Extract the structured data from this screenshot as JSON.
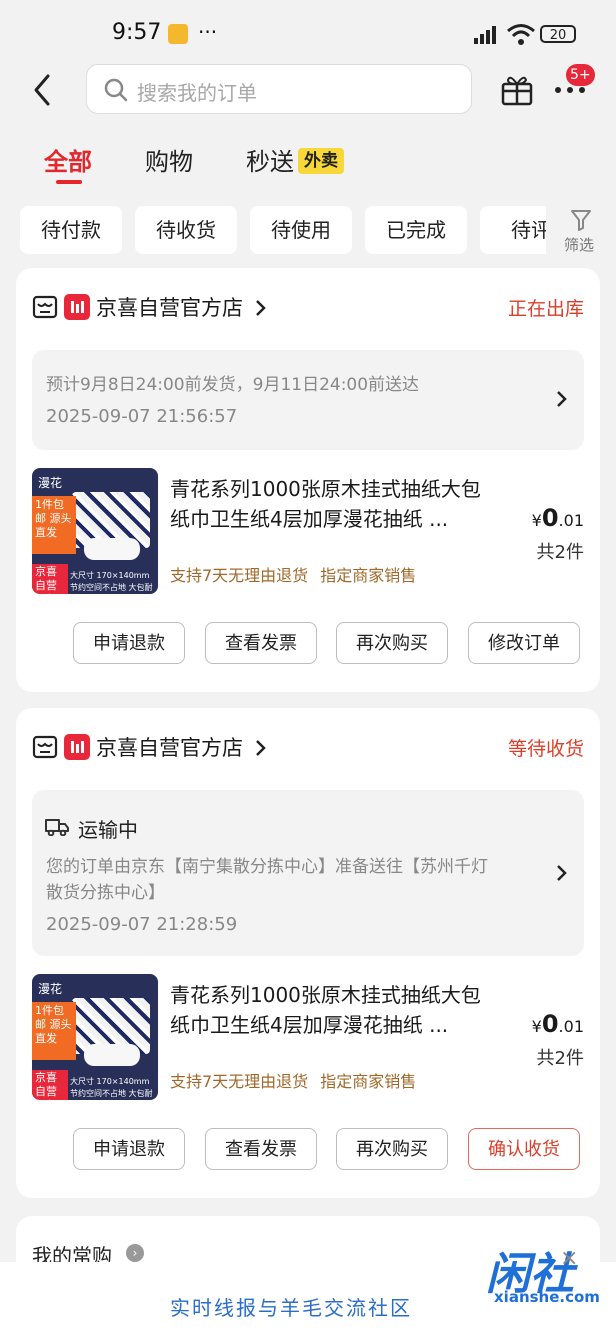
{
  "status_bar": {
    "time": "9:57",
    "dots": "···",
    "battery": "20"
  },
  "search": {
    "placeholder": "搜索我的订单"
  },
  "header": {
    "badge": "5+"
  },
  "tabs": [
    {
      "label": "全部",
      "active": true
    },
    {
      "label": "购物",
      "active": false
    },
    {
      "label": "秒送",
      "active": false,
      "tag": "外卖"
    }
  ],
  "filters": [
    "待付款",
    "待收货",
    "待使用",
    "已完成",
    "待评"
  ],
  "filter_button": "筛选",
  "orders": [
    {
      "shop": "京喜自营官方店",
      "status": "正在出库",
      "ship_lines": [
        "预计9月8日24:00前发货，9月11日24:00前送达"
      ],
      "time": "2025-09-07 21:56:57",
      "product": {
        "title": "青花系列1000张原木挂式抽纸大包纸巾卫生纸4层加厚漫花抽纸 ...",
        "price_symbol": "¥",
        "price_int": "0",
        "price_dec": ".01",
        "qty": "共2件",
        "tags": [
          "支持7天无理由退货",
          "指定商家销售"
        ]
      },
      "buttons": [
        "申请退款",
        "查看发票",
        "再次购买",
        "修改订单"
      ]
    },
    {
      "shop": "京喜自营官方店",
      "status": "等待收货",
      "transit_title": "运输中",
      "ship_lines": [
        "您的订单由京东【南宁集散分拣中心】准备送往【苏州千灯",
        "散货分拣中心】"
      ],
      "time": "2025-09-07 21:28:59",
      "product": {
        "title": "青花系列1000张原木挂式抽纸大包纸巾卫生纸4层加厚漫花抽纸 ...",
        "price_symbol": "¥",
        "price_int": "0",
        "price_dec": ".01",
        "qty": "共2件",
        "tags": [
          "支持7天无理由退货",
          "指定商家销售"
        ]
      },
      "buttons": [
        "申请退款",
        "查看发票",
        "再次购买",
        "确认收货"
      ]
    }
  ],
  "thumb": {
    "brand": "漫花",
    "promo": "1件包邮 源头直发",
    "promo2": "京喜自营 包邮",
    "size": "大尺寸 170×140mm",
    "slogan": "节约空间不占地 大包耐用"
  },
  "frequent": {
    "title": "我的常购"
  },
  "watermark": {
    "slogan": "实时线报与羊毛交流社区",
    "logo": "闲社",
    "domain": "xianshe.com"
  },
  "colors": {
    "accent": "#e3272d",
    "status": "#d9402b",
    "tag": "#a2682a"
  }
}
